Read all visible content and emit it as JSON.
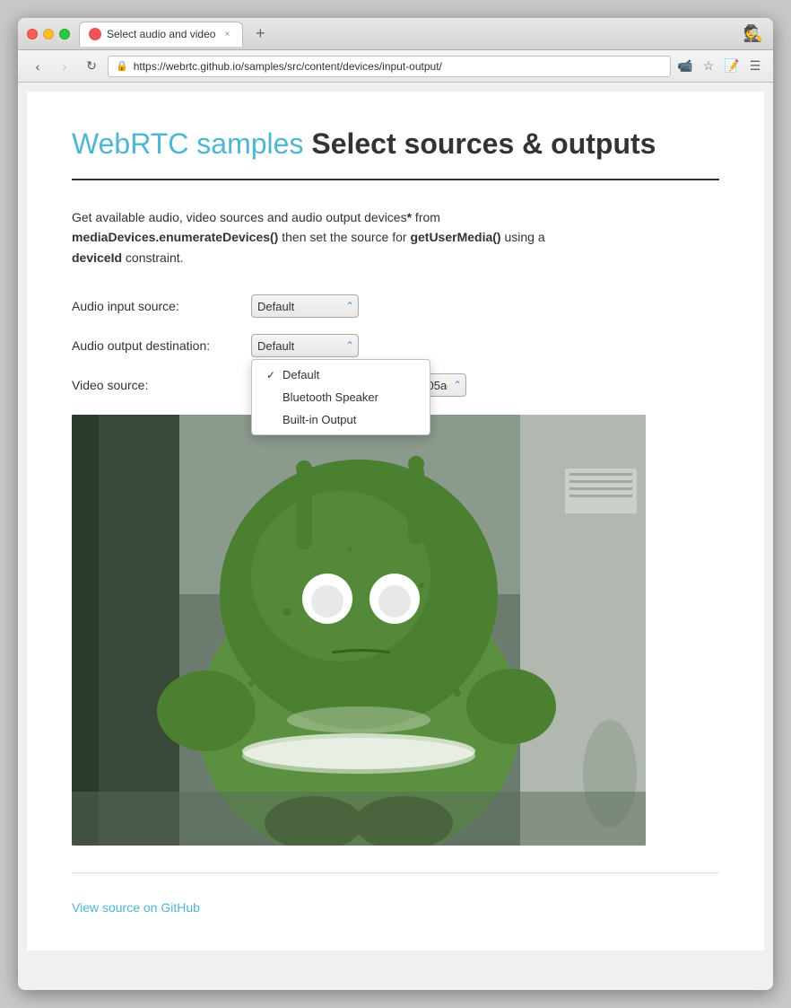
{
  "browser": {
    "tab_title": "Select audio and video",
    "url": "https://webrtc.github.io/samples/src/content/devices/input-output/",
    "tab_close_label": "×",
    "new_tab_label": "+"
  },
  "nav": {
    "back_label": "‹",
    "forward_label": "›",
    "refresh_label": "↻"
  },
  "page": {
    "brand": "WebRTC samples",
    "title": "Select sources & outputs",
    "description_part1": "Get available audio, video sources and audio output devices",
    "description_bold1": "*",
    "description_part2": " from ",
    "description_code1": "mediaDevices.enumerateDevices()",
    "description_part3": " then set the source for ",
    "description_code2": "getUserMedia()",
    "description_part4": " using a ",
    "description_code3": "deviceId",
    "description_part5": " constraint.",
    "audio_input_label": "Audio input source:",
    "audio_output_label": "Audio output destination:",
    "video_source_label": "Video source:",
    "audio_input_default": "Default",
    "audio_output_options": [
      {
        "label": "Default",
        "selected": true
      },
      {
        "label": "Bluetooth Speaker",
        "selected": false
      },
      {
        "label": "Built-in Output",
        "selected": false
      }
    ],
    "video_source_value": "FaceTime HD Camera (Built-in) (05ac:8510)",
    "github_link_text": "View source on GitHub"
  }
}
